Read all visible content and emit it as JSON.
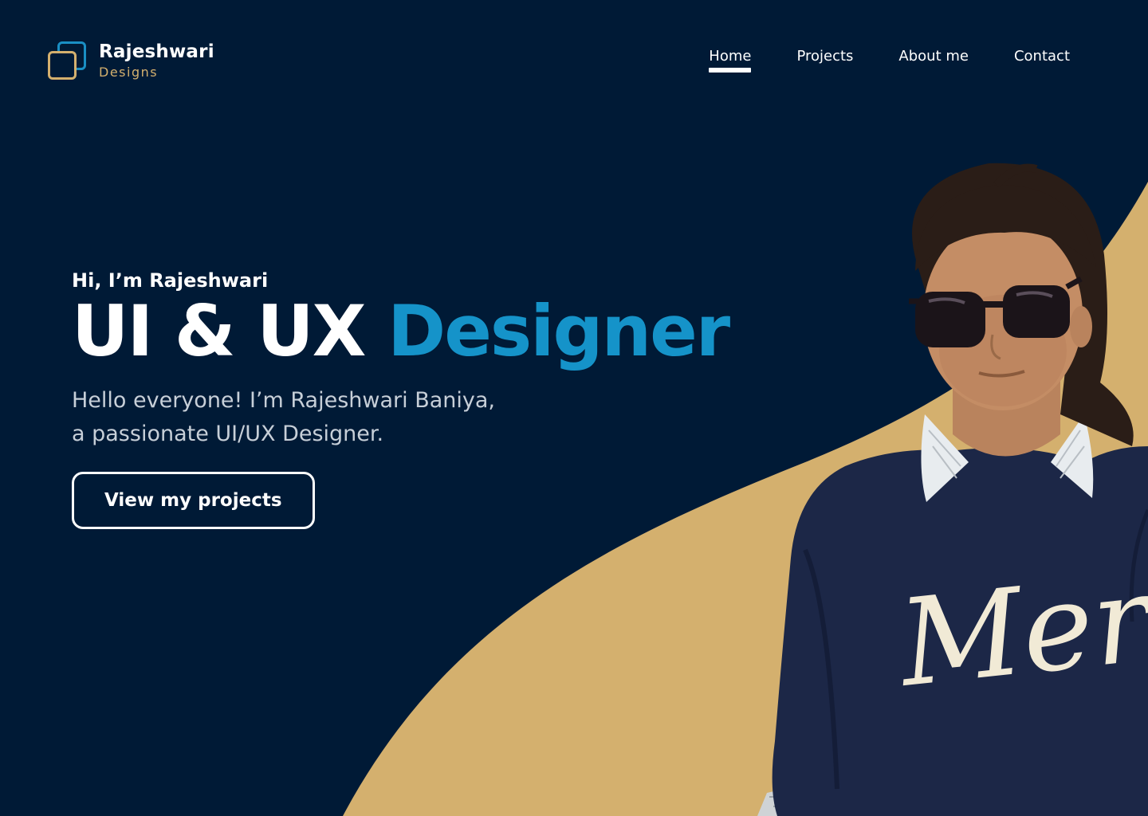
{
  "brand": {
    "name": "Rajeshwari",
    "subtitle": "Designs"
  },
  "nav": {
    "items": [
      {
        "label": "Home",
        "active": true
      },
      {
        "label": "Projects",
        "active": false
      },
      {
        "label": "About me",
        "active": false
      },
      {
        "label": "Contact",
        "active": false
      }
    ]
  },
  "hero": {
    "greeting": "Hi, I’m Rajeshwari",
    "title_part1": "UI & UX",
    "title_part2": "Designer",
    "description_line1": "Hello everyone! I’m Rajeshwari Baniya,",
    "description_line2": "a passionate UI/UX Designer.",
    "cta_label": "View my projects"
  },
  "portrait": {
    "shirt_text": "Merci"
  },
  "colors": {
    "background": "#001a36",
    "accent_blue": "#1593c9",
    "accent_gold": "#d4b06e",
    "text_light": "#c7cfd8"
  },
  "icons": {
    "logo": "overlapping-squares-logo"
  }
}
